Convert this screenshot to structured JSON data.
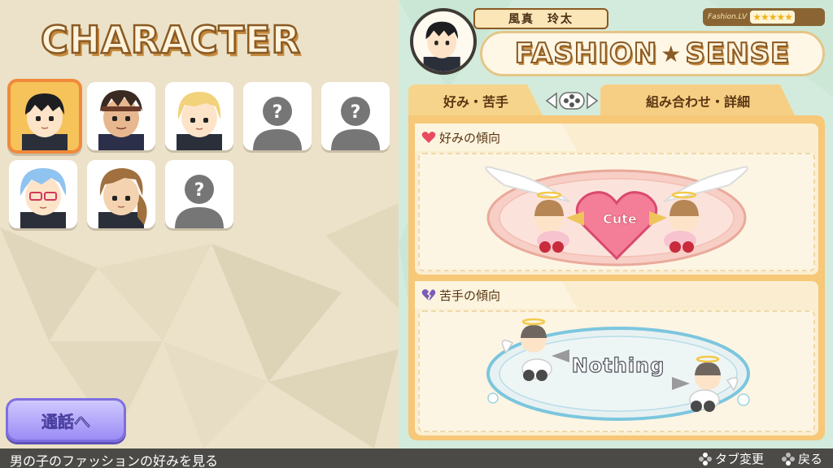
{
  "left_panel": {
    "title": "CHARACTER",
    "characters": [
      {
        "name": "black-hair-boy",
        "unlocked": true,
        "selected": true
      },
      {
        "name": "headband-boy",
        "unlocked": true,
        "selected": false
      },
      {
        "name": "blonde-boy",
        "unlocked": true,
        "selected": false
      },
      {
        "name": "locked-slot",
        "unlocked": false,
        "label": "?"
      },
      {
        "name": "locked-slot",
        "unlocked": false,
        "label": "?"
      },
      {
        "name": "blue-hair-glasses-boy",
        "unlocked": true,
        "selected": false
      },
      {
        "name": "brown-long-hair-boy",
        "unlocked": true,
        "selected": false
      },
      {
        "name": "locked-slot",
        "unlocked": false,
        "label": "?"
      }
    ],
    "call_button": "通話へ"
  },
  "right_panel": {
    "character_name": "風真　玲太",
    "level_label": "Fashion.LV",
    "level_stars": 5,
    "level_stars_text": "★★★★★",
    "banner_left": "FASHION",
    "banner_star": "★",
    "banner_right": "SENSE",
    "tabs": [
      {
        "label": "好み・苦手",
        "active": true
      },
      {
        "label": "組み合わせ・詳細",
        "active": false
      }
    ],
    "likes": {
      "header": "好みの傾向",
      "icon": "heart-icon",
      "value": "Cute"
    },
    "dislikes": {
      "header": "苦手の傾向",
      "icon": "broken-heart-icon",
      "value": "Nothing"
    }
  },
  "bottom_bar": {
    "hint": "男の子のファッションの好みを見る",
    "controls": [
      {
        "icon": "dpad-icon",
        "label": "タブ変更"
      },
      {
        "icon": "dpad-icon",
        "label": "戻る"
      }
    ]
  },
  "colors": {
    "accent_orange": "#f08a3a",
    "panel_orange": "#f6c878",
    "call_button": "#9b8cf5",
    "like_pink": "#f37a8a",
    "dislike_blue": "#7cc6de"
  }
}
